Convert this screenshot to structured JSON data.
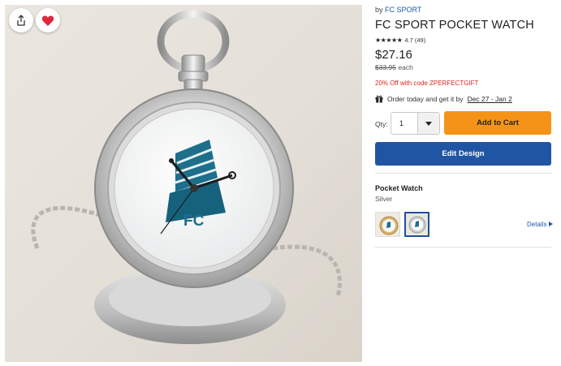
{
  "product": {
    "by_prefix": "by",
    "brand": "FC SPORT",
    "title": "FC SPORT POCKET WATCH",
    "stars": "★★★★★",
    "rating_text": "4.7 (49)",
    "price": "$27.16",
    "old_price": "$33.95",
    "price_unit": "each",
    "promo": "20% Off with code ZPERFECTGIFT",
    "delivery_prefix": "Order today and get it by",
    "delivery_date": "Dec 27 - Jan 2"
  },
  "watch_face": {
    "logo_text": "FC"
  },
  "purchase": {
    "qty_label": "Qty:",
    "qty_value": "1",
    "add_to_cart": "Add to Cart",
    "edit_design": "Edit Design"
  },
  "option": {
    "title": "Pocket Watch",
    "subtitle": "Silver",
    "details_link": "Details"
  },
  "icons": {
    "share": "share-icon",
    "favorite": "heart-icon",
    "gift": "gift-icon",
    "caret": "chevron-down-icon",
    "details_arrow": "caret-right-icon"
  },
  "colors": {
    "accent_orange": "#f59318",
    "brand_blue": "#2055a4",
    "promo_red": "#e0261b",
    "heart_red": "#e0263a",
    "logo_teal": "#1e6f8c"
  }
}
